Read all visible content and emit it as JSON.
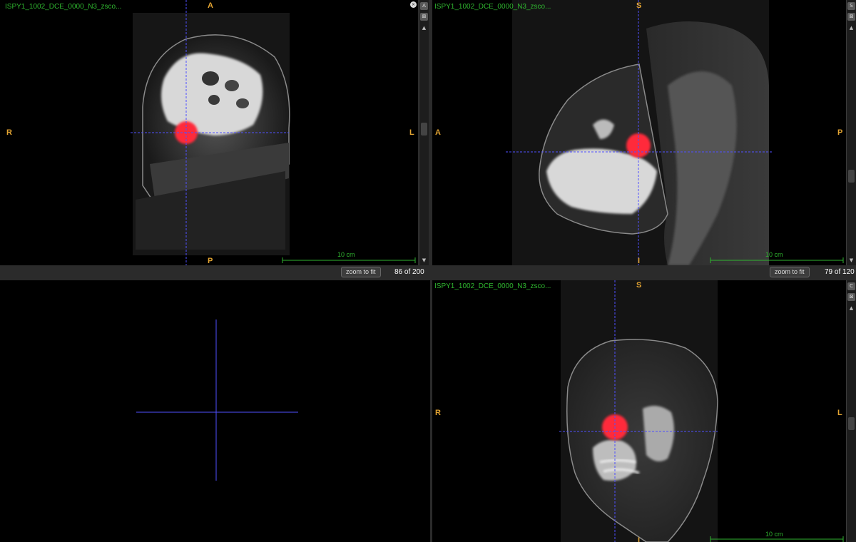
{
  "viewers": {
    "axial": {
      "series_name": "ISPY1_1002_DCE_0000_N3_zsco...",
      "orient": {
        "top": "A",
        "bottom": "P",
        "left": "R",
        "right": "L"
      },
      "scale_label": "10 cm",
      "zoom_label": "zoom to fit",
      "slice": "86 of 200",
      "scroll_btn": "A"
    },
    "sagittal": {
      "series_name": "ISPY1_1002_DCE_0000_N3_zsco...",
      "orient": {
        "top": "S",
        "bottom": "I",
        "left": "A",
        "right": "P"
      },
      "scale_label": "10 cm",
      "zoom_label": "zoom to fit",
      "slice": "79 of 120",
      "scroll_btn": "S"
    },
    "empty": {},
    "coronal": {
      "series_name": "ISPY1_1002_DCE_0000_N3_zsco...",
      "orient": {
        "top": "S",
        "bottom": "I",
        "left": "R",
        "right": "L"
      },
      "scale_label": "10 cm",
      "scroll_btn": "C"
    }
  },
  "colors": {
    "crosshair": "#5050ff",
    "segmentation": "#ff2a3a",
    "series_text": "#2fb52f",
    "orientation_text": "#e3a432"
  },
  "icons": [
    "close-icon",
    "collapse-icon",
    "expand-icon",
    "scroll-up-arrow-icon",
    "scroll-down-arrow-icon"
  ]
}
